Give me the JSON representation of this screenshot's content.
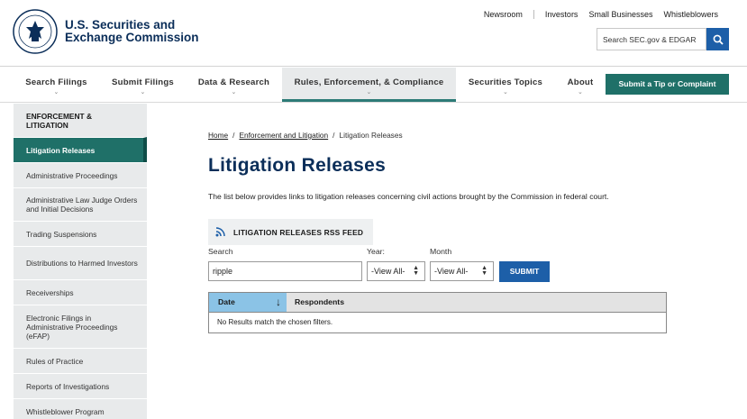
{
  "header": {
    "brand_line1": "U.S. Securities and",
    "brand_line2": "Exchange Commission",
    "top_links": [
      "Newsroom",
      "Investors",
      "Small Businesses",
      "Whistleblowers"
    ],
    "search_placeholder": "Search SEC.gov & EDGAR",
    "search_icon": "search-icon"
  },
  "nav": {
    "items": [
      {
        "label": "Search Filings"
      },
      {
        "label": "Submit Filings"
      },
      {
        "label": "Data & Research"
      },
      {
        "label": "Rules, Enforcement, & Compliance"
      },
      {
        "label": "Securities Topics"
      },
      {
        "label": "About"
      }
    ],
    "active_index": 3,
    "tip_button": "Submit a Tip or Complaint"
  },
  "sidebar": {
    "heading": "ENFORCEMENT & LITIGATION",
    "items": [
      {
        "label": "Litigation Releases"
      },
      {
        "label": "Administrative Proceedings"
      },
      {
        "label": "Administrative Law Judge Orders and Initial Decisions"
      },
      {
        "label": "Trading Suspensions"
      },
      {
        "label": "Distributions to Harmed Investors"
      },
      {
        "label": "Receiverships"
      },
      {
        "label": "Electronic Filings in Administrative Proceedings (eFAP)"
      },
      {
        "label": "Rules of Practice"
      },
      {
        "label": "Reports of Investigations"
      },
      {
        "label": "Whistleblower Program"
      }
    ]
  },
  "breadcrumb": {
    "home": "Home",
    "parent": "Enforcement and Litigation",
    "current": "Litigation Releases",
    "separator": "/"
  },
  "main": {
    "title": "Litigation Releases",
    "description": "The list below provides links to litigation releases concerning civil actions brought by the Commission in federal court.",
    "rss_label": "LITIGATION RELEASES RSS FEED"
  },
  "filters": {
    "search_label": "Search",
    "search_value": "ripple",
    "year_label": "Year:",
    "year_value": "-View All-",
    "month_label": "Month",
    "month_value": "-View All-",
    "submit_label": "SUBMIT"
  },
  "table": {
    "columns": [
      "Date",
      "Respondents"
    ],
    "sort_glyph": "↓",
    "empty_message": "No Results match the chosen filters."
  },
  "colors": {
    "brand_navy": "#0b2e59",
    "teal": "#1f7068",
    "link_blue": "#1d5fa8",
    "sort_header": "#8bc3e6"
  }
}
